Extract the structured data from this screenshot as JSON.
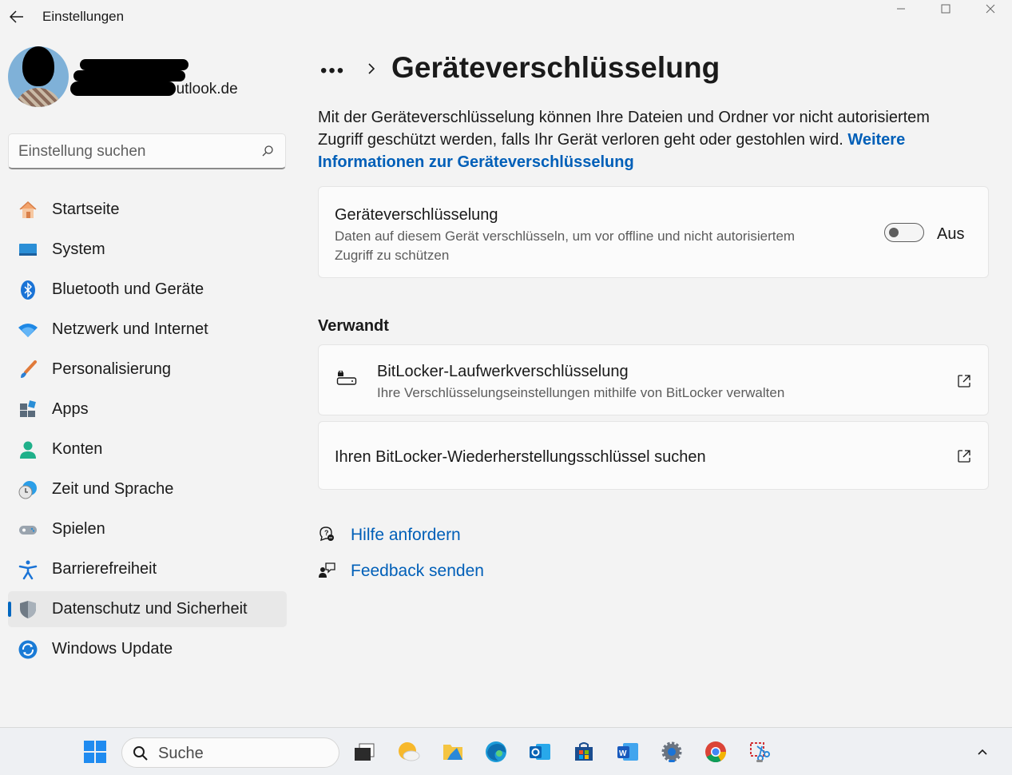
{
  "window": {
    "title": "Einstellungen",
    "back_icon": "arrow-left-icon",
    "controls": [
      "minimize-icon",
      "maximize-icon",
      "close-icon"
    ]
  },
  "profile": {
    "name": "",
    "email": "outlook.de"
  },
  "search": {
    "placeholder": "Einstellung suchen",
    "value": ""
  },
  "nav": {
    "items": [
      {
        "label": "Startseite",
        "icon": "home-icon"
      },
      {
        "label": "System",
        "icon": "monitor-icon"
      },
      {
        "label": "Bluetooth und Geräte",
        "icon": "bluetooth-icon"
      },
      {
        "label": "Netzwerk und Internet",
        "icon": "wifi-icon"
      },
      {
        "label": "Personalisierung",
        "icon": "brush-icon"
      },
      {
        "label": "Apps",
        "icon": "apps-icon"
      },
      {
        "label": "Konten",
        "icon": "person-icon"
      },
      {
        "label": "Zeit und Sprache",
        "icon": "clock-globe-icon"
      },
      {
        "label": "Spielen",
        "icon": "gamepad-icon"
      },
      {
        "label": "Barrierefreiheit",
        "icon": "accessibility-icon"
      },
      {
        "label": "Datenschutz und Sicherheit",
        "icon": "shield-icon",
        "active": true
      },
      {
        "label": "Windows Update",
        "icon": "update-icon"
      }
    ]
  },
  "main": {
    "breadcrumb_more": "•••",
    "title": "Geräteverschlüsselung",
    "intro_text": "Mit der Geräteverschlüsselung können Ihre Dateien und Ordner vor nicht autorisiertem Zugriff geschützt werden, falls Ihr Gerät verloren geht oder gestohlen wird.",
    "intro_link": "Weitere Informationen zur Geräteverschlüsselung",
    "encryption_card": {
      "title": "Geräteverschlüsselung",
      "description": "Daten auf diesem Gerät verschlüsseln, um vor offline und nicht autorisiertem Zugriff zu schützen",
      "toggle_on": false,
      "toggle_label": "Aus"
    },
    "related": {
      "heading": "Verwandt",
      "bitlocker": {
        "title": "BitLocker-Laufwerkverschlüsselung",
        "description": "Ihre Verschlüsselungseinstellungen mithilfe von BitLocker verwalten",
        "icon": "drive-lock-icon"
      },
      "recovery": {
        "title": "Ihren BitLocker-Wiederherstellungsschlüssel suchen"
      }
    },
    "help": {
      "get_help": "Hilfe anfordern",
      "feedback": "Feedback senden"
    }
  },
  "taskbar": {
    "search_label": "Suche",
    "apps": [
      "start-icon",
      "task-view-icon",
      "weather-icon",
      "file-explorer-icon",
      "edge-icon",
      "outlook-icon",
      "store-icon",
      "word-icon",
      "settings-icon",
      "chrome-icon",
      "snipping-tool-icon"
    ],
    "tray": [
      "chevron-up-icon"
    ]
  },
  "colors": {
    "accent": "#0067c0",
    "link": "#005fb8",
    "background": "#f3f3f3",
    "card": "#fbfbfb"
  }
}
